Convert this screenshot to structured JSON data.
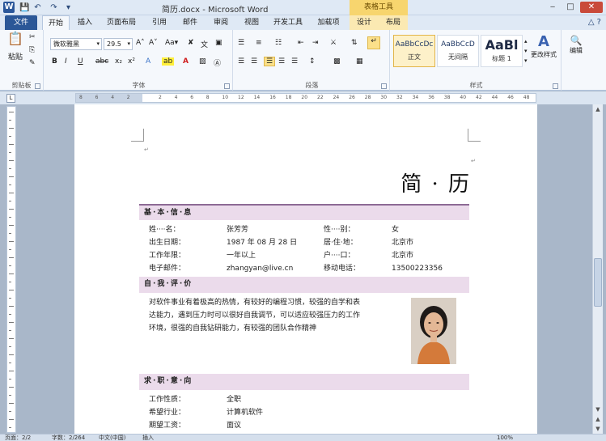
{
  "window": {
    "title": "简历.docx - Microsoft Word",
    "context_tab_group": "表格工具",
    "app_icon": "W"
  },
  "tabs": [
    {
      "label": "文件"
    },
    {
      "label": "开始"
    },
    {
      "label": "插入"
    },
    {
      "label": "页面布局"
    },
    {
      "label": "引用"
    },
    {
      "label": "邮件"
    },
    {
      "label": "审阅"
    },
    {
      "label": "视图"
    },
    {
      "label": "开发工具"
    },
    {
      "label": "加载项"
    },
    {
      "label": "设计"
    },
    {
      "label": "布局"
    }
  ],
  "ribbon": {
    "clipboard": {
      "label": "剪贴板",
      "paste": "粘贴"
    },
    "font": {
      "label": "字体",
      "font_name": "微软雅黑",
      "font_size": "29.5"
    },
    "paragraph": {
      "label": "段落"
    },
    "styles": {
      "label": "样式",
      "items": [
        {
          "sample": "AaBbCcDc",
          "name": "正文"
        },
        {
          "sample": "AaBbCcD",
          "name": "无间隔"
        },
        {
          "sample": "AaBl",
          "name": "标题 1"
        }
      ],
      "change_styles": "更改样式"
    },
    "editing": {
      "label": "编辑"
    }
  },
  "ruler_ticks": [
    "8",
    "6",
    "4",
    "2",
    "",
    "2",
    "4",
    "6",
    "8",
    "10",
    "12",
    "14",
    "16",
    "18",
    "20",
    "22",
    "24",
    "26",
    "28",
    "30",
    "32",
    "34",
    "36",
    "38",
    "40",
    "42",
    "44",
    "46",
    "48"
  ],
  "document": {
    "title": "简 · 历",
    "sections": {
      "basic": {
        "heading": "基·本·信·息",
        "rows": [
          {
            "l1": "姓····名：",
            "v1": "张芳芳",
            "l2": "性····别：",
            "v2": "女"
          },
          {
            "l1": "出生日期：",
            "v1": "1987 年 08 月 28 日",
            "l2": "居·住·地：",
            "v2": "北京市"
          },
          {
            "l1": "工作年限：",
            "v1": "一年以上",
            "l2": "户····口：",
            "v2": "北京市"
          },
          {
            "l1": "电子邮件：",
            "v1": "zhangyan@live.cn",
            "l2": "移动电话：",
            "v2": "13500223356"
          }
        ]
      },
      "eval": {
        "heading": "自·我·评·价",
        "lines": [
          "对软件事业有着极高的热情，有较好的编程习惯，较强的自学和表",
          "达能力，遇到压力时可以很好自我调节，可以适应较强压力的工作",
          "环境，很强的自我钻研能力，有较强的团队合作精神"
        ]
      },
      "job": {
        "heading": "求·职·意·向",
        "rows": [
          {
            "l1": "工作性质：",
            "v1": "全职"
          },
          {
            "l1": "希望行业：",
            "v1": "计算机软件"
          },
          {
            "l1": "期望工资：",
            "v1": "面议"
          }
        ]
      }
    }
  },
  "status": {
    "page": "页面：2/2",
    "words": "字数：2/264",
    "lang": "中文(中国)",
    "mode": "插入",
    "zoom": "100%"
  }
}
